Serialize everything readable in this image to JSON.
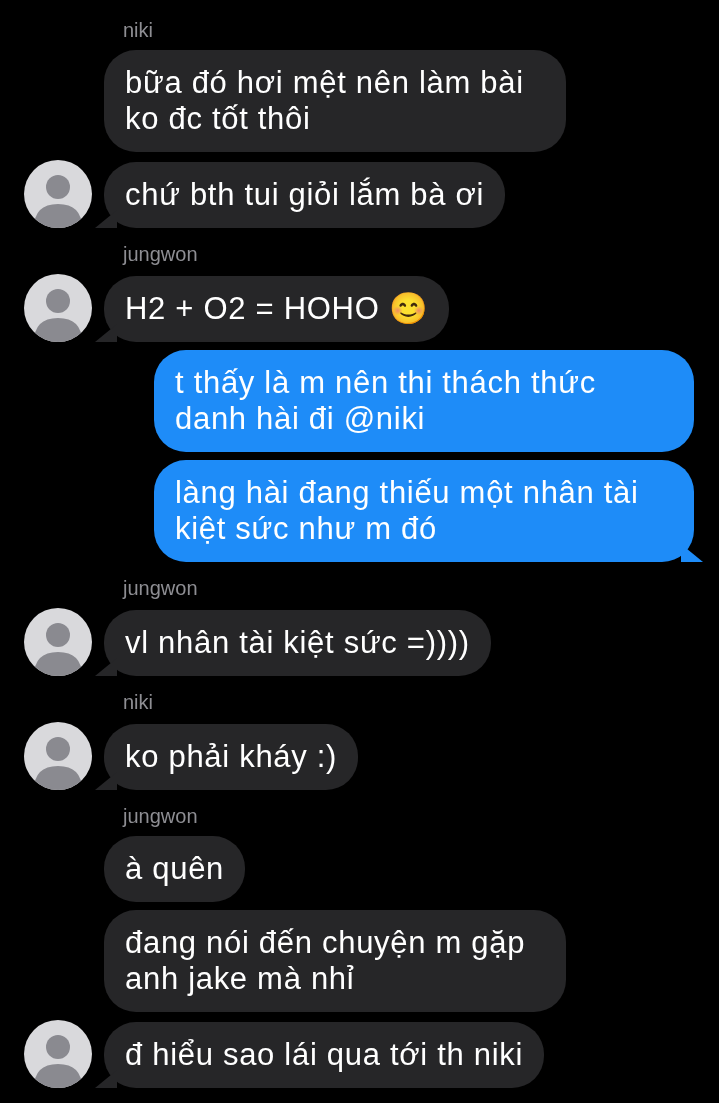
{
  "messages": [
    {
      "kind": "incoming",
      "sender": "niki",
      "text": "bữa đó hơi mệt nên làm bài ko đc tốt thôi",
      "tail": false
    },
    {
      "kind": "incoming",
      "text": "chứ bth tui giỏi lắm bà ơi",
      "tail": true
    },
    {
      "kind": "incoming",
      "sender": "jungwon",
      "text": "H2 + O2 = HOHO 😊",
      "tail": true
    },
    {
      "kind": "outgoing",
      "text": "t thấy là m nên thi thách thức danh hài đi @niki",
      "tail": false
    },
    {
      "kind": "outgoing",
      "text": "làng hài đang thiếu một nhân tài kiệt sức như m đó",
      "tail": true
    },
    {
      "kind": "incoming",
      "sender": "jungwon",
      "text": "vl nhân tài kiệt sức =))))",
      "tail": true
    },
    {
      "kind": "incoming",
      "sender": "niki",
      "text": "ko phải kháy :)",
      "tail": true
    },
    {
      "kind": "incoming",
      "sender": "jungwon",
      "text": "à quên",
      "tail": false
    },
    {
      "kind": "incoming",
      "text": "đang nói đến chuyện m gặp anh jake mà nhỉ",
      "tail": false
    },
    {
      "kind": "incoming",
      "text": "đ hiểu sao lái qua tới th niki",
      "tail": true
    }
  ]
}
